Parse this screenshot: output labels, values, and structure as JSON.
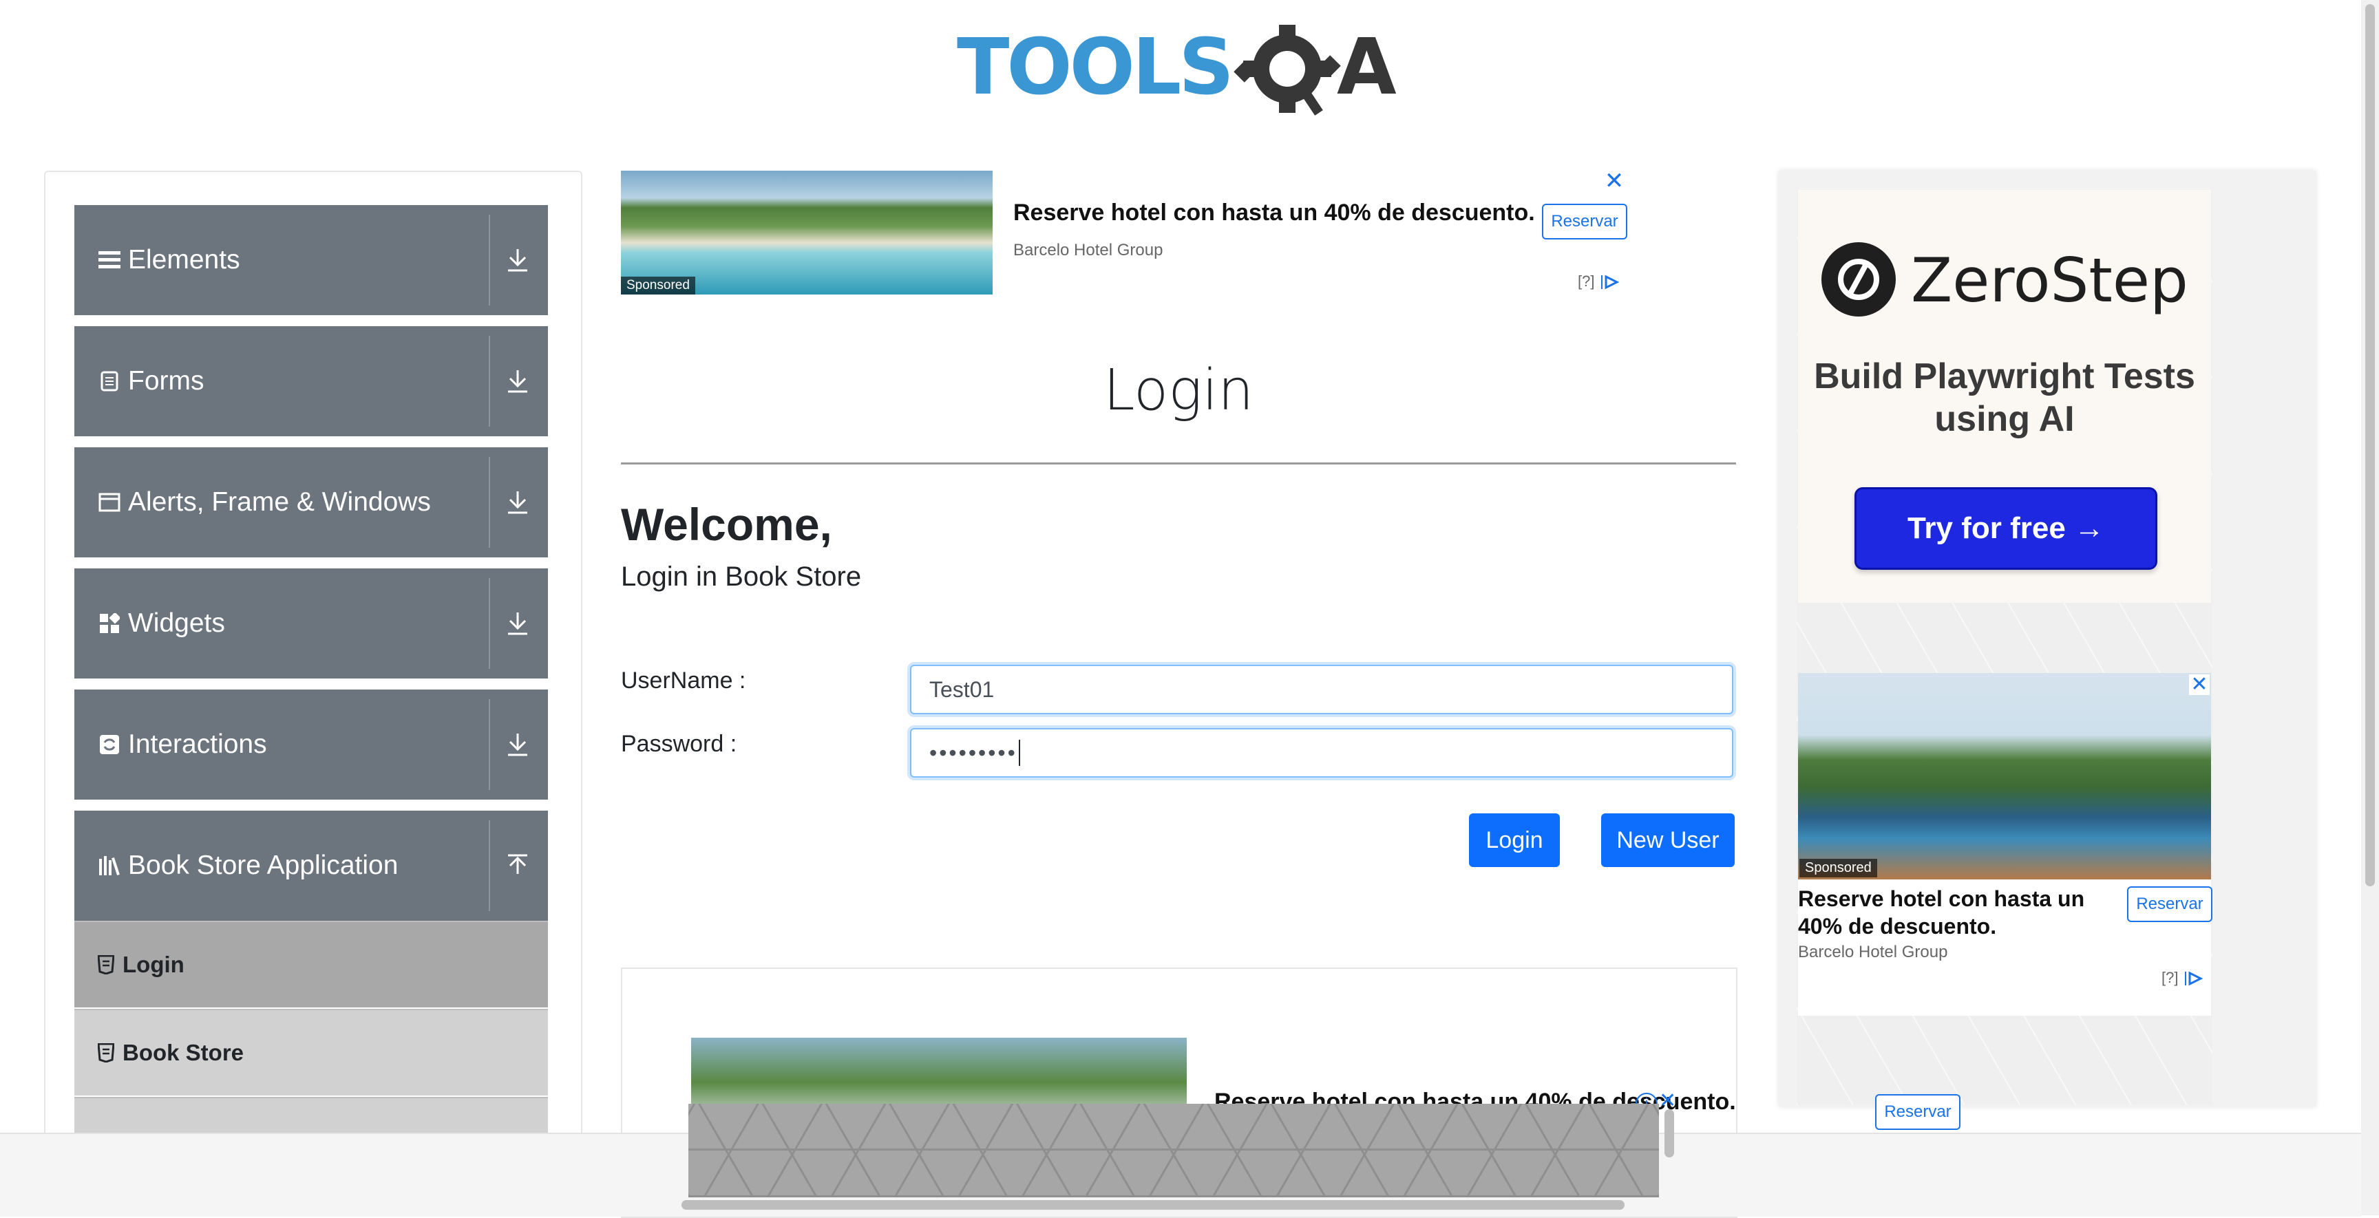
{
  "logo": {
    "brand": "TOOLSQA",
    "left_text": "TOOLS",
    "right_text": "A"
  },
  "sidebar": {
    "groups": [
      {
        "label": "Elements",
        "icon": "hamburger-icon"
      },
      {
        "label": "Forms",
        "icon": "document-icon"
      },
      {
        "label": "Alerts, Frame & Windows",
        "icon": "window-icon"
      },
      {
        "label": "Widgets",
        "icon": "widgets-icon"
      },
      {
        "label": "Interactions",
        "icon": "interactions-icon"
      },
      {
        "label": "Book Store Application",
        "icon": "library-icon",
        "expanded": true
      }
    ],
    "subitems": [
      {
        "label": "Login",
        "active": true
      },
      {
        "label": "Book Store",
        "active": false
      }
    ]
  },
  "top_ad": {
    "title": "Reserve hotel con hasta un 40% de descuento.",
    "advertiser": "Barcelo Hotel Group",
    "button": "Reservar",
    "sponsored": "Sponsored",
    "close": "✕",
    "choices": "[?]"
  },
  "main": {
    "title": "Login",
    "welcome": "Welcome,",
    "subtitle": "Login in Book Store",
    "username_label": "UserName :",
    "username_value": "Test01",
    "password_label": "Password :",
    "password_value": "•••••••••",
    "login_button": "Login",
    "new_user_button": "New User"
  },
  "bottom_ad": {
    "title": "Reserve hotel con hasta un 40% de descuento.",
    "close": "✕",
    "info": "i"
  },
  "right_ad": {
    "brand": "ZeroStep",
    "tagline": "Build Playwright Tests using AI",
    "cta": "Try for free →",
    "hotel_title": "Reserve hotel con hasta un 40% de descuento.",
    "hotel_advertiser": "Barcelo Hotel Group",
    "hotel_button": "Reservar",
    "hotel_sponsored": "Sponsored",
    "hotel_choices": "[?]",
    "extra_button": "Reservar"
  },
  "colors": {
    "sidebar_group_bg": "#6c757d",
    "sidebar_active": "#a8a8a8",
    "primary_button": "#0d6efd",
    "zerostep_cta": "#1d28e0",
    "logo_blue": "#3b97d3",
    "logo_dark": "#373737"
  }
}
